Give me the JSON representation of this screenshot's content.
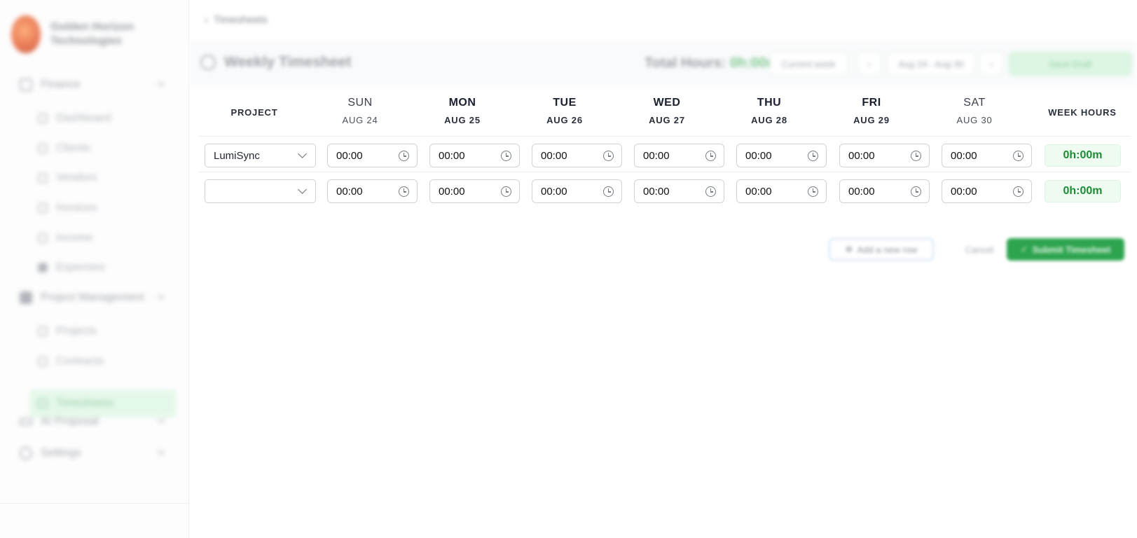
{
  "brand": {
    "name": "Golden Horizon Technologies"
  },
  "sidebar": {
    "items": [
      {
        "label": "Finance",
        "icon": "user-icon",
        "top": 0
      },
      {
        "label": "Project Management",
        "icon": "briefcase-icon"
      },
      {
        "label": "AI Proposal",
        "icon": "code-icon"
      },
      {
        "label": "Settings",
        "icon": "gear-icon"
      }
    ],
    "finance_sub": [
      "Dashboard",
      "Clients",
      "Vendors",
      "Invoices",
      "Income",
      "Expenses"
    ],
    "pm_sub": [
      "Projects",
      "Contracts",
      "Timesheets"
    ],
    "active": "Timesheets"
  },
  "breadcrumb": {
    "label": "Timesheets"
  },
  "header": {
    "title": "Weekly Timesheet",
    "total_label": "Total Hours:",
    "total_value": "0h:00m",
    "current_week": "Current week",
    "range": "Aug 24 - Aug 30",
    "save_draft": "Save Draft"
  },
  "table": {
    "project_header": "PROJECT",
    "week_hours_header": "WEEK HOURS",
    "days": [
      {
        "day": "SUN",
        "date": "AUG 24"
      },
      {
        "day": "MON",
        "date": "AUG 25"
      },
      {
        "day": "TUE",
        "date": "AUG 26"
      },
      {
        "day": "WED",
        "date": "AUG 27"
      },
      {
        "day": "THU",
        "date": "AUG 28"
      },
      {
        "day": "FRI",
        "date": "AUG 29"
      },
      {
        "day": "SAT",
        "date": "AUG 30"
      }
    ],
    "rows": [
      {
        "project": "LumiSync",
        "times": [
          "00:00",
          "00:00",
          "00:00",
          "00:00",
          "00:00",
          "00:00",
          "00:00"
        ],
        "total": "0h:00m"
      },
      {
        "project": "",
        "times": [
          "00:00",
          "00:00",
          "00:00",
          "00:00",
          "00:00",
          "00:00",
          "00:00"
        ],
        "total": "0h:00m"
      }
    ]
  },
  "actions": {
    "add_row": "Add a new row",
    "cancel": "Cancel",
    "submit": "Submit Timesheet"
  },
  "colors": {
    "accent": "#2ea44f",
    "hours_bg": "#eefbf1",
    "hours_text": "#1e8a36",
    "active_nav": "#dff7e6"
  }
}
